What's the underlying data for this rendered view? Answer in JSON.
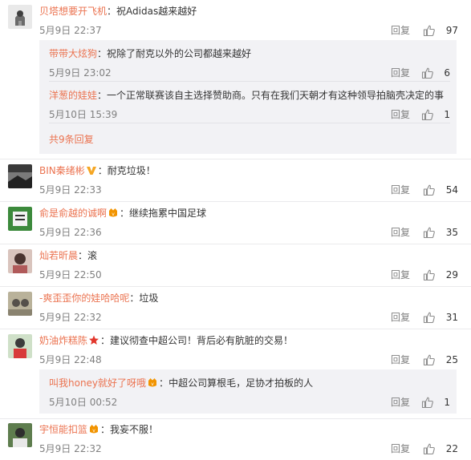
{
  "comments": [
    {
      "user": "贝塔想要开飞机",
      "text": "祝Adidas越来越好",
      "time": "5月9日 22:37",
      "reply_label": "回复",
      "likes": "97",
      "sub_replies": [
        {
          "user": "带带大炫狗",
          "text": "祝除了耐克以外的公司都越来越好",
          "time": "5月9日 23:02",
          "reply_label": "回复",
          "likes": "6"
        },
        {
          "user": "洋葱的娃娃",
          "text": "一个正常联赛该自主选择赞助商。只有在我们天朝才有这种领导拍脑壳决定的事",
          "time": "5月10日 15:39",
          "reply_label": "回复",
          "likes": "1"
        }
      ],
      "more_label": "共9条回复"
    },
    {
      "user": "BIN秦绪彬",
      "badge": "v-icon",
      "text": "耐克垃圾！",
      "time": "5月9日 22:33",
      "reply_label": "回复",
      "likes": "54"
    },
    {
      "user": "俞是俞越的诚啊",
      "badge": "vip-icon",
      "text": "继续拖累中国足球",
      "time": "5月9日 22:36",
      "reply_label": "回复",
      "likes": "35"
    },
    {
      "user": "灿若昕晨",
      "text": "滚",
      "time": "5月9日 22:50",
      "reply_label": "回复",
      "likes": "29"
    },
    {
      "user": "-爽歪歪你的娃哈哈呢",
      "text": "垃圾",
      "time": "5月9日 22:32",
      "reply_label": "回复",
      "likes": "31"
    },
    {
      "user": "奶油炸糕陈",
      "badge": "star-icon",
      "text": "建议彻查中超公司！背后必有肮脏的交易！",
      "time": "5月9日 22:48",
      "reply_label": "回复",
      "likes": "25",
      "sub_replies": [
        {
          "user": "叫我honey就好了呀哦",
          "badge": "vip-icon",
          "text": "中超公司算根毛，足协才拍板的人",
          "time": "5月10日 00:52",
          "reply_label": "回复",
          "likes": "1"
        }
      ]
    },
    {
      "user": "宇恒能扣篮",
      "badge": "vip-icon",
      "text": "我妄不服！",
      "time": "5月9日 22:32",
      "reply_label": "回复",
      "likes": "22"
    }
  ],
  "colors": {
    "username": "#eb7350",
    "meta": "#808080",
    "subbg": "#f2f2f5"
  }
}
